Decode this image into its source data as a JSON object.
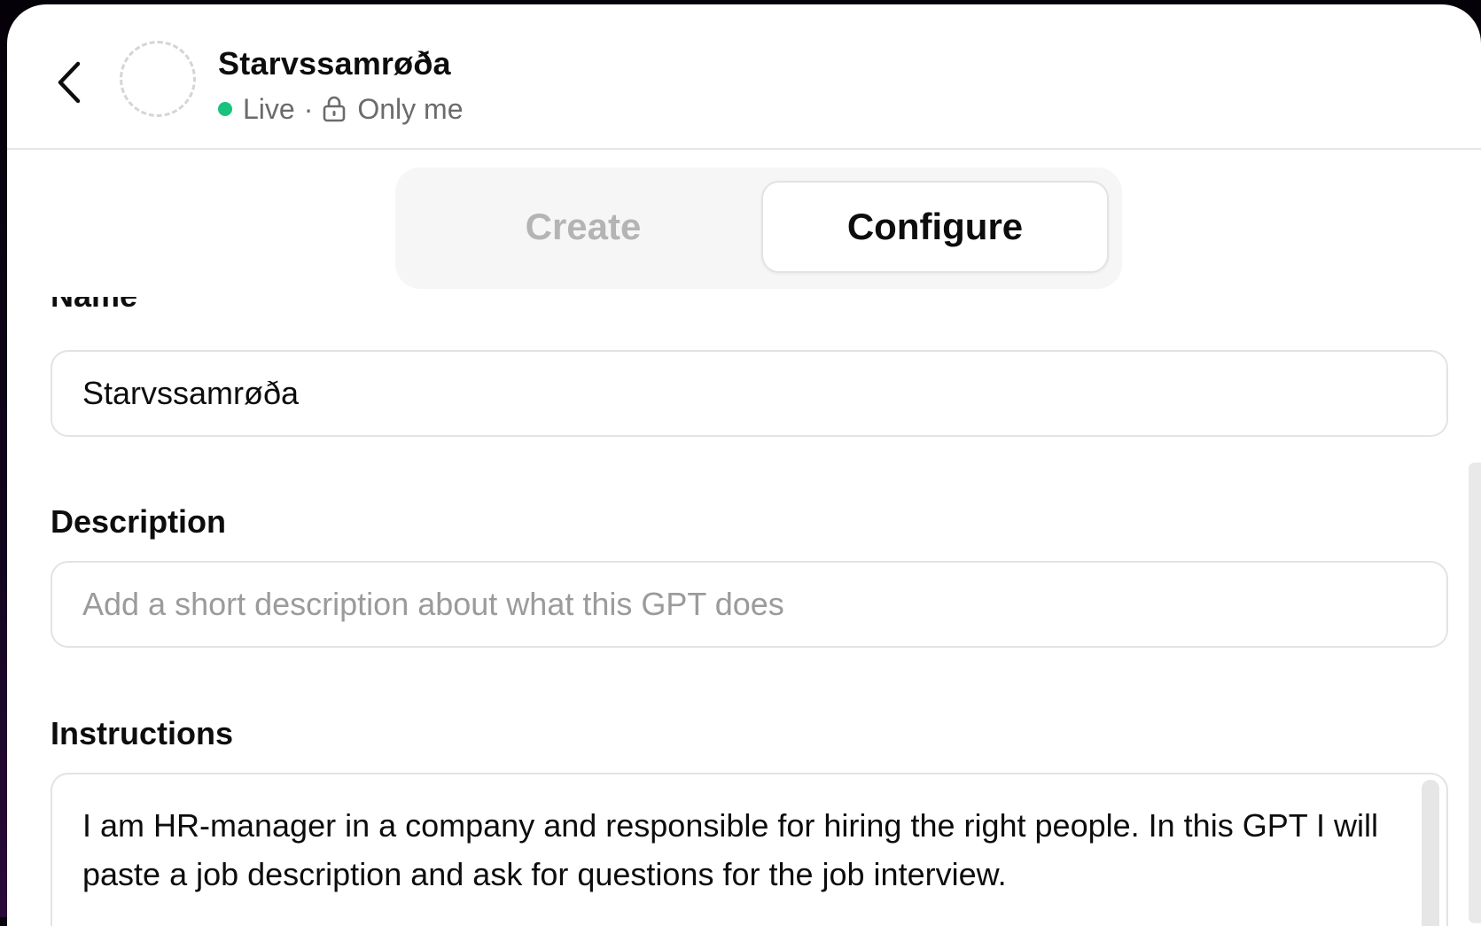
{
  "header": {
    "gpt_name": "Starvssamrøða",
    "status": "Live",
    "separator": "·",
    "visibility": "Only me",
    "status_color": "#19c37d"
  },
  "tabs": [
    {
      "label": "Create",
      "active": false
    },
    {
      "label": "Configure",
      "active": true
    }
  ],
  "form": {
    "name_label": "Name",
    "name_value": "Starvssamrøða",
    "description_label": "Description",
    "description_value": "",
    "description_placeholder": "Add a short description about what this GPT does",
    "instructions_label": "Instructions",
    "instructions_value": "I am HR-manager in a company and responsible for hiring the right people. In this GPT I will paste a job description and ask for questions for the job interview."
  },
  "icons": {
    "back": "chevron-left-icon",
    "lock": "lock-icon",
    "avatar": "dashed-circle-avatar"
  }
}
